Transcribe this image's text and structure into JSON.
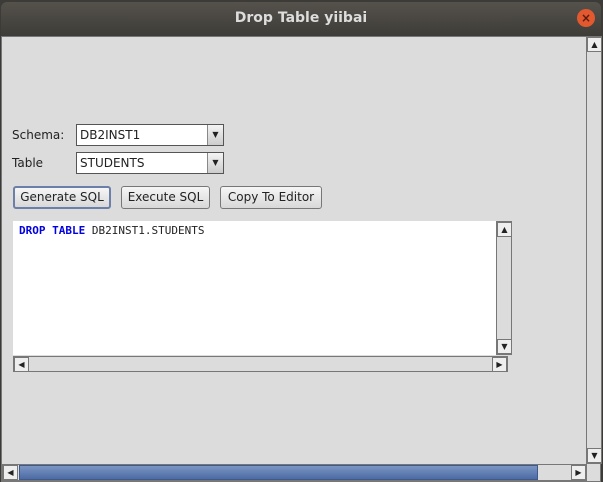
{
  "window": {
    "title": "Drop Table yiibai"
  },
  "form": {
    "schema_label": "Schema:",
    "schema_value": "DB2INST1",
    "table_label": "Table",
    "table_value": "STUDENTS"
  },
  "buttons": {
    "generate": "Generate SQL",
    "execute": "Execute SQL",
    "copy": "Copy To Editor"
  },
  "editor": {
    "kw1": "DROP",
    "kw2": "TABLE",
    "rest": "DB2INST1.STUDENTS"
  },
  "icons": {
    "close": "×",
    "up": "▲",
    "down": "▼",
    "left": "◀",
    "right": "▶"
  }
}
